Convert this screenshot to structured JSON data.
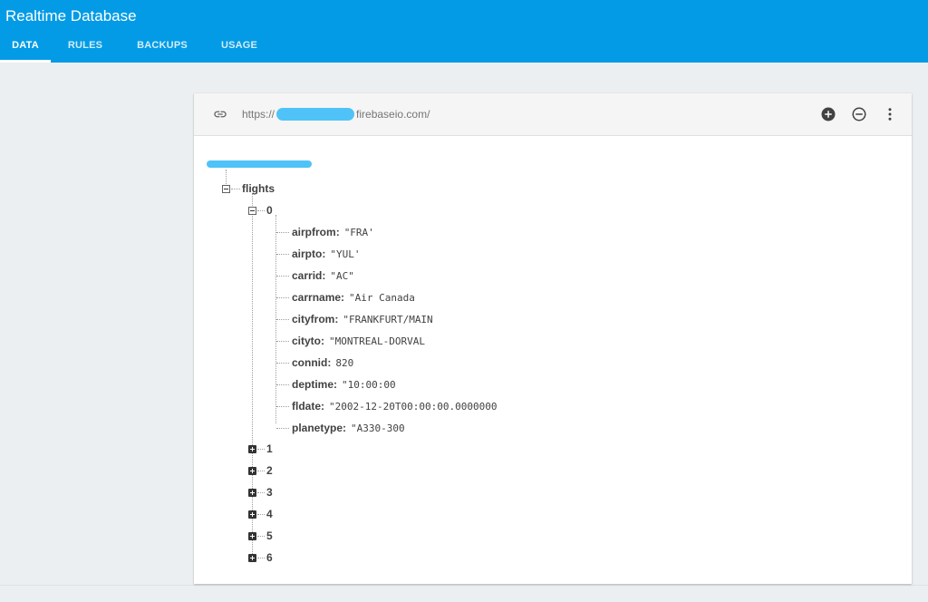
{
  "app": {
    "title": "Realtime Database"
  },
  "tabs": [
    {
      "label": "DATA",
      "active": true
    },
    {
      "label": "RULES",
      "active": false
    },
    {
      "label": "BACKUPS",
      "active": false
    },
    {
      "label": "USAGE",
      "active": false
    }
  ],
  "toolbar": {
    "url_prefix": "https://",
    "url_suffix": "firebaseio.com/",
    "icons": {
      "link": "link-icon",
      "add": "add-circle-icon",
      "remove": "remove-circle-icon",
      "menu": "more-vert-icon"
    }
  },
  "tree": {
    "flights": {
      "label": "flights",
      "expanded_child": {
        "key": "0",
        "fields": [
          {
            "key": "airpfrom",
            "value": "\"FRA'"
          },
          {
            "key": "airpto",
            "value": "\"YUL'"
          },
          {
            "key": "carrid",
            "value": "\"AC\""
          },
          {
            "key": "carrname",
            "value": "\"Air Canada"
          },
          {
            "key": "cityfrom",
            "value": "\"FRANKFURT/MAIN"
          },
          {
            "key": "cityto",
            "value": "\"MONTREAL-DORVAL"
          },
          {
            "key": "connid",
            "value": "820"
          },
          {
            "key": "deptime",
            "value": "\"10:00:00"
          },
          {
            "key": "fldate",
            "value": "\"2002-12-20T00:00:00.0000000"
          },
          {
            "key": "planetype",
            "value": "\"A330-300"
          }
        ]
      },
      "collapsed_children": [
        "1",
        "2",
        "3",
        "4",
        "5",
        "6"
      ]
    }
  },
  "colors": {
    "header": "#039be5",
    "background": "#eceff1",
    "masked": "#4fc3f7"
  }
}
